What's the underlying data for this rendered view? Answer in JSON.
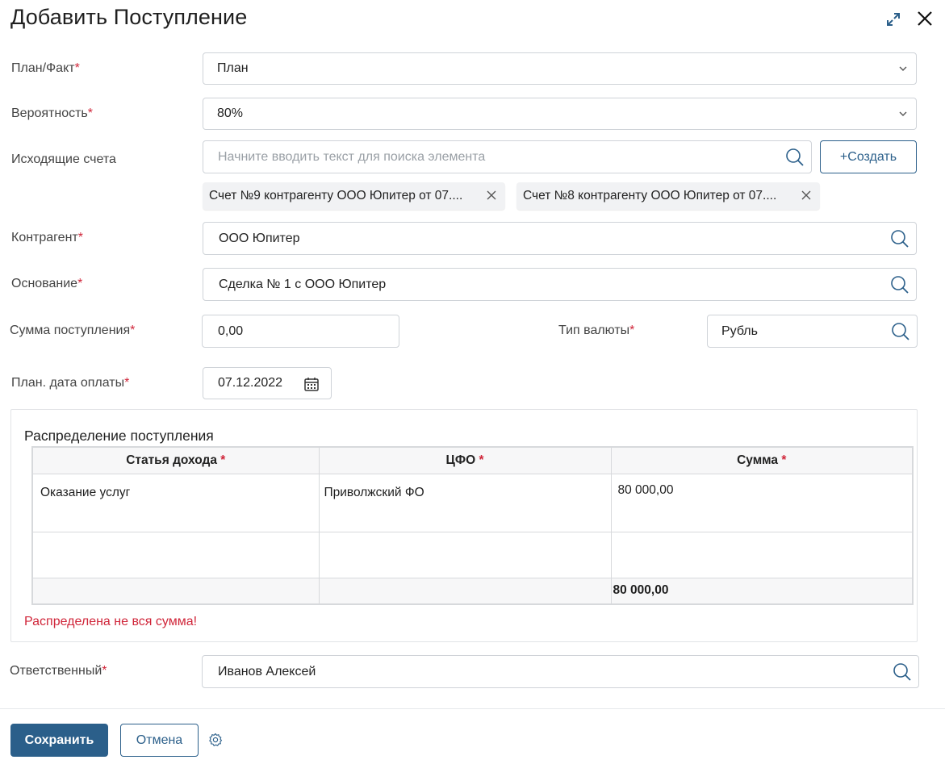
{
  "dialog": {
    "title": "Добавить Поступление",
    "expand_icon": "expand-diagonal-icon",
    "close_icon": "close-icon"
  },
  "form": {
    "required_mark": "*",
    "plan_fact": {
      "label": "План/Факт",
      "value": "План"
    },
    "probability": {
      "label": "Вероятность",
      "value": "80%"
    },
    "outgoing_invoices": {
      "label": "Исходящие счета",
      "placeholder": "Начните вводить текст для поиска элемента",
      "create_label": "+Создать",
      "chips": [
        "Счет №9 контрагенту ООО Юпитер от 07....",
        "Счет №8 контрагенту ООО Юпитер от 07...."
      ]
    },
    "counterparty": {
      "label": "Контрагент",
      "value": "ООО Юпитер"
    },
    "basis": {
      "label": "Основание",
      "value": "Сделка № 1 с ООО Юпитер"
    },
    "amount": {
      "label": "Сумма поступления",
      "value": "0,00"
    },
    "currency": {
      "label": "Тип валюты",
      "value": "Рубль"
    },
    "pay_date": {
      "label": "План. дата оплаты",
      "value": "07.12.2022"
    },
    "responsible": {
      "label": "Ответственный",
      "value": "Иванов Алексей"
    }
  },
  "distribution": {
    "title": "Распределение поступления",
    "columns": [
      "Статья дохода",
      "ЦФО",
      "Сумма"
    ],
    "rows": [
      [
        "Оказание услуг",
        "Приволжский ФО",
        "80 000,00"
      ],
      [
        "",
        "",
        ""
      ]
    ],
    "total": "80 000,00",
    "error": "Распределена не вся сумма!"
  },
  "footer": {
    "save_label": "Сохранить",
    "cancel_label": "Отмена",
    "settings_icon": "gear-icon"
  },
  "colors": {
    "accent": "#2b5f8a",
    "required": "#d0263a",
    "border": "#cfd3d8"
  }
}
